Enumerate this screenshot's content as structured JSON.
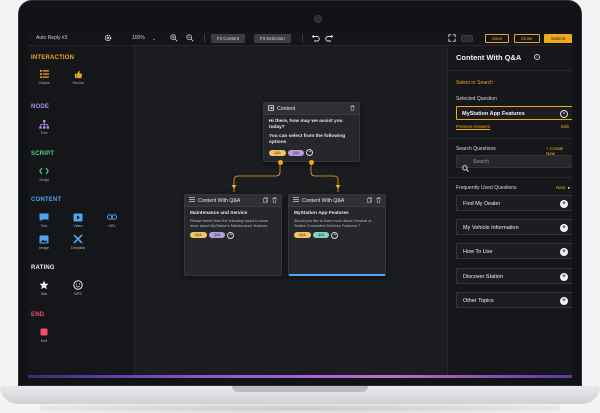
{
  "toolbar": {
    "title": "Auto Reply #3",
    "zoom": "100%",
    "fit_content": "Fit Content",
    "fit_selection": "Fit Selection",
    "save": "Save",
    "close": "Close",
    "submit": "Submit"
  },
  "sidebar": {
    "interaction": {
      "title": "INTERACTION",
      "items": [
        {
          "label": "Choice"
        },
        {
          "label": "Yes-No"
        }
      ]
    },
    "node": {
      "title": "NODE",
      "items": [
        {
          "label": "Tree"
        }
      ]
    },
    "script": {
      "title": "SCRIPT",
      "items": [
        {
          "label": "Script"
        }
      ]
    },
    "content": {
      "title": "CONTENT",
      "items": [
        {
          "label": "Text"
        },
        {
          "label": "Video"
        },
        {
          "label": "URL"
        },
        {
          "label": "Image"
        },
        {
          "label": "Deeplink"
        }
      ]
    },
    "rating": {
      "title": "RATING",
      "items": [
        {
          "label": "Star"
        },
        {
          "label": "NPS"
        }
      ]
    },
    "end": {
      "title": "END",
      "items": [
        {
          "label": "End"
        }
      ]
    },
    "colors": {
      "interaction": "#f0a81e",
      "node": "#b48cf2",
      "script": "#52d37a",
      "content": "#4ea4f0",
      "rating": "#e8e9ec",
      "end": "#ef4f6b"
    }
  },
  "canvas": {
    "content_node": {
      "title": "Content",
      "greeting": "Hi there, how may we assist you today?",
      "prompt": "You can select from the following options",
      "pills": [
        "Q&A",
        "Q&A"
      ]
    },
    "qa_node_left": {
      "title": "Content With Q&A",
      "heading": "Maintenance and Service",
      "text": "Please select from the following topics to learn more about MyStation's Maintenance features",
      "pills": [
        "Q&A",
        "Q&A"
      ]
    },
    "qa_node_right": {
      "title": "Content With Q&A",
      "heading": "MyStation App Features",
      "text": "Would you like to learn more about General or Station Connected Services Features ?",
      "pills": [
        "Q&A",
        "Q&A"
      ]
    }
  },
  "panel": {
    "title": "Content With Q&A",
    "select_or_search": "Select or Search",
    "selected_question_label": "Selected Question",
    "selected_question": "MyStation App Features",
    "preview_answers": "Preview Answers",
    "edit": "Edit",
    "search_label": "Search Questions",
    "create_new": "+ Create New",
    "search_placeholder": "Search",
    "frequent_label": "Frequently Used Questions",
    "next": "Next",
    "questions": [
      "Find My Dealer",
      "My Vehicle Information",
      "How To Use",
      "Discover Station",
      "Other Topics"
    ]
  }
}
